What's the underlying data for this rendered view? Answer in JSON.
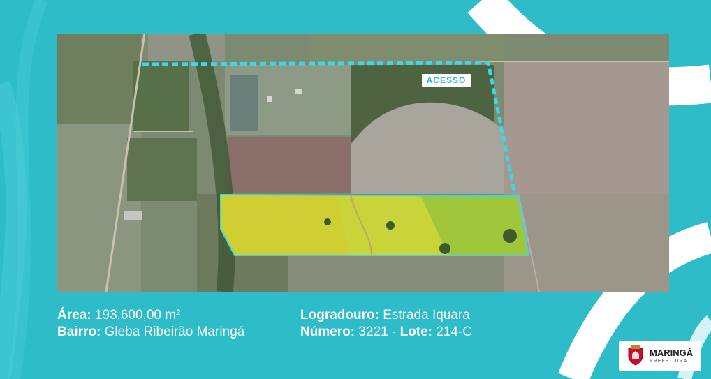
{
  "map": {
    "access_label": "ACESSO"
  },
  "info": {
    "area_label": "Área:",
    "area_value": "193.600,00 m²",
    "bairro_label": "Bairro:",
    "bairro_value": "Gleba Ribeirão Maringá",
    "logradouro_label": "Logradouro:",
    "logradouro_value": "Estrada Iquara",
    "numero_label": "Número:",
    "numero_value": "3221 -",
    "lote_label": "Lote:",
    "lote_value": "214-C"
  },
  "logo": {
    "name": "MARINGÁ",
    "subtitle": "PREFEITURA",
    "icon": "city-crest-icon"
  },
  "colors": {
    "background": "#2dbcc8",
    "access_outline": "#3ad8e8",
    "highlight_outline": "#3ad8e8",
    "highlight_fill": "#c9d43a"
  }
}
